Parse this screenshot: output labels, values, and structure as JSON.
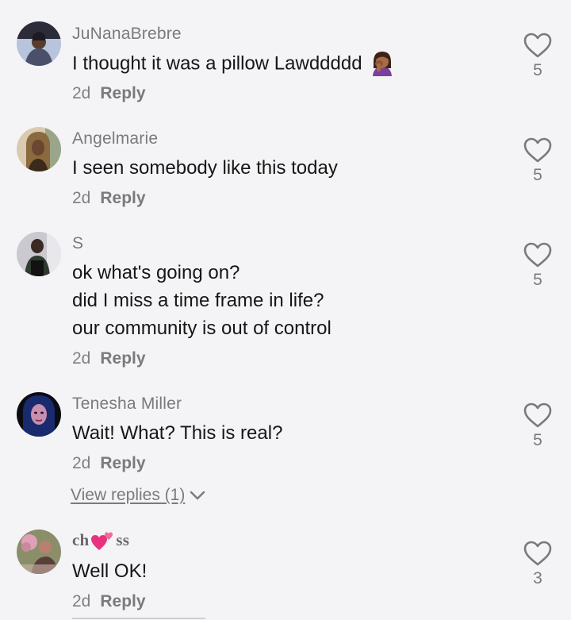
{
  "comments": [
    {
      "username": "JuNanaBrebre",
      "lines": [
        "I thought it was a pillow Lawddddd"
      ],
      "emoji": "woman-facepalming-emoji",
      "age": "2d",
      "reply_label": "Reply",
      "likes": "5",
      "avatar_colors": [
        "#4a4f6a",
        "#b8c4dc",
        "#2c2b3a"
      ]
    },
    {
      "username": "Angelmarie",
      "lines": [
        "I seen somebody like this today"
      ],
      "age": "2d",
      "reply_label": "Reply",
      "likes": "5",
      "avatar_colors": [
        "#8a6a3e",
        "#d9cbb0",
        "#3b2a1c"
      ]
    },
    {
      "username": "S",
      "lines": [
        "ok what's going on?",
        "did I miss a time frame in life?",
        "our community is out of control"
      ],
      "age": "2d",
      "reply_label": "Reply",
      "likes": "5",
      "avatar_colors": [
        "#2e3b2f",
        "#c9c9cf",
        "#121212"
      ]
    },
    {
      "username": "Tenesha Miller",
      "lines": [
        "Wait! What? This is real?"
      ],
      "age": "2d",
      "reply_label": "Reply",
      "likes": "5",
      "avatar_colors": [
        "#1a2a6e",
        "#c68fb0",
        "#0b0b12"
      ],
      "view_replies": "View replies (1)"
    },
    {
      "username_parts": [
        "ch",
        "ss"
      ],
      "lines": [
        "Well OK!"
      ],
      "age": "2d",
      "reply_label": "Reply",
      "likes": "3",
      "avatar_colors": [
        "#c98aa0",
        "#8a8f6a",
        "#5a3e3a"
      ]
    }
  ],
  "colors": {
    "background": "#f4f4f6",
    "username": "#7a7a7e",
    "text": "#161616",
    "heart_outline": "#7a7a7e",
    "hearts_emoji": "#e8327d"
  },
  "icons": {
    "like": "heart-outline-icon",
    "expand": "chevron-down-icon",
    "name_decoration": "two-hearts-emoji"
  }
}
